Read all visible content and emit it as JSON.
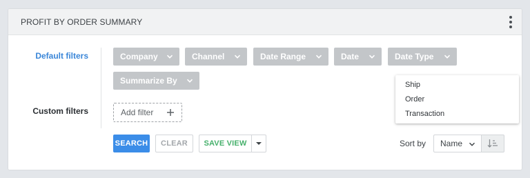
{
  "panel": {
    "title": "PROFIT BY ORDER SUMMARY",
    "menu_icon": "kebab-vertical-icon"
  },
  "filters": {
    "default_label": "Default filters",
    "custom_label": "Custom filters",
    "chips": [
      {
        "label": "Company"
      },
      {
        "label": "Channel"
      },
      {
        "label": "Date Range"
      },
      {
        "label": "Date"
      },
      {
        "label": "Date Type"
      },
      {
        "label": "Summarize By"
      }
    ],
    "add_filter_label": "Add filter"
  },
  "date_type_dropdown": {
    "options": [
      "Ship",
      "Order",
      "Transaction"
    ]
  },
  "actions": {
    "search_label": "SEARCH",
    "clear_label": "CLEAR",
    "save_view_label": "SAVE VIEW"
  },
  "sort": {
    "label": "Sort by",
    "selected": "Name",
    "direction_icon": "sort-ascending-icon"
  },
  "colors": {
    "accent_blue": "#3b8de8",
    "save_green": "#46b06b",
    "chip_gray": "#c3c6c9"
  }
}
